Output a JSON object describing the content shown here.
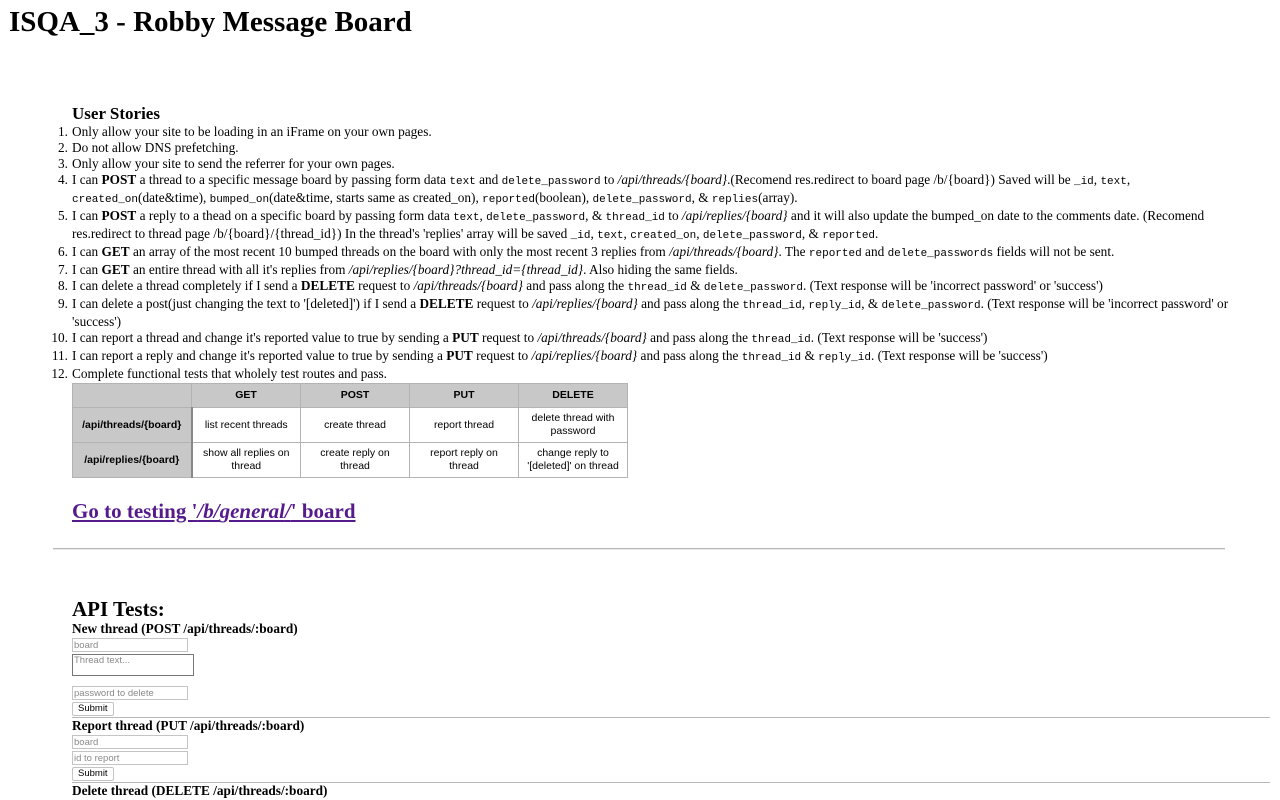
{
  "page": {
    "title": "ISQA_3 - Robby Message Board"
  },
  "stories": {
    "heading": "User Stories",
    "items": {
      "s1": "Only allow your site to be loading in an iFrame on your own pages.",
      "s2": "Do not allow DNS prefetching.",
      "s3": "Only allow your site to send the referrer for your own pages.",
      "s4": {
        "a": "I can ",
        "b": "POST",
        "c": " a thread to a specific message board by passing form data ",
        "d": "text",
        "e": " and ",
        "f": "delete_password",
        "g": " to ",
        "h": "/api/threads/{board}",
        "i": ".(Recomend res.redirect to board page /b/{board}) Saved will be ",
        "j": "_id",
        "k": ", ",
        "l": "text",
        "m": ", ",
        "n": "created_on",
        "o": "(date&time), ",
        "p": "bumped_on",
        "q": "(date&time, starts same as created_on), ",
        "r": "reported",
        "s": "(boolean), ",
        "t": "delete_password",
        "u": ", & ",
        "v": "replies",
        "w": "(array)."
      },
      "s5": {
        "a": "I can ",
        "b": "POST",
        "c": " a reply to a thead on a specific board by passing form data ",
        "d": "text",
        "e": ", ",
        "f": "delete_password",
        "g": ", & ",
        "h": "thread_id",
        "i": " to ",
        "j": "/api/replies/{board}",
        "k": " and it will also update the bumped_on date to the comments date. (Recomend res.redirect to thread page /b/{board}/{thread_id}) In the thread's 'replies' array will be saved ",
        "l": "_id",
        "m": ", ",
        "n": "text",
        "o": ", ",
        "p": "created_on",
        "q": ", ",
        "r": "delete_password",
        "s": ", & ",
        "t": "reported",
        "u": "."
      },
      "s6": {
        "a": "I can ",
        "b": "GET",
        "c": " an array of the most recent 10 bumped threads on the board with only the most recent 3 replies from ",
        "d": "/api/threads/{board}",
        "e": ". The ",
        "f": "reported",
        "g": " and ",
        "h": "delete_passwords",
        "i": " fields will not be sent."
      },
      "s7": {
        "a": "I can ",
        "b": "GET",
        "c": " an entire thread with all it's replies from ",
        "d": "/api/replies/{board}?thread_id={thread_id}",
        "e": ". Also hiding the same fields."
      },
      "s8": {
        "a": "I can delete a thread completely if I send a ",
        "b": "DELETE",
        "c": " request to ",
        "d": "/api/threads/{board}",
        "e": " and pass along the ",
        "f": "thread_id",
        "g": " & ",
        "h": "delete_password",
        "i": ". (Text response will be 'incorrect password' or 'success')"
      },
      "s9": {
        "a": "I can delete a post(just changing the text to '[deleted]') if I send a ",
        "b": "DELETE",
        "c": " request to ",
        "d": "/api/replies/{board}",
        "e": " and pass along the ",
        "f": "thread_id",
        "g": ", ",
        "h": "reply_id",
        "i": ", & ",
        "j": "delete_password",
        "k": ". (Text response will be 'incorrect password' or 'success')"
      },
      "s10": {
        "a": "I can report a thread and change it's reported value to true by sending a ",
        "b": "PUT",
        "c": " request to ",
        "d": "/api/threads/{board}",
        "e": " and pass along the ",
        "f": "thread_id",
        "g": ". (Text response will be 'success')"
      },
      "s11": {
        "a": "I can report a reply and change it's reported value to true by sending a ",
        "b": "PUT",
        "c": " request to ",
        "d": "/api/replies/{board}",
        "e": " and pass along the ",
        "f": "thread_id",
        "g": " & ",
        "h": "reply_id",
        "i": ". (Text response will be 'success')"
      },
      "s12": "Complete functional tests that wholely test routes and pass."
    }
  },
  "routes_table": {
    "headers": [
      "",
      "GET",
      "POST",
      "PUT",
      "DELETE"
    ],
    "rows": [
      {
        "route": "/api/threads/{board}",
        "get": "list recent threads",
        "post": "create thread",
        "put": "report thread",
        "delete": "delete thread with password"
      },
      {
        "route": "/api/replies/{board}",
        "get": "show all replies on thread",
        "post": "create reply on thread",
        "put": "report reply on thread",
        "delete": "change reply to '[deleted]' on thread"
      }
    ]
  },
  "test_link": {
    "before": "Go to testing '",
    "path_a": "/b/",
    "path_b": "general",
    "path_c": "/",
    "after": "' board"
  },
  "api_tests": {
    "heading": "API Tests:",
    "new_thread": {
      "title": "New thread (POST /api/threads/:board)",
      "board_placeholder": "board",
      "text_placeholder": "Thread text...",
      "password_placeholder": "password to delete",
      "submit": "Submit"
    },
    "report_thread": {
      "title": "Report thread (PUT /api/threads/:board)",
      "board_placeholder": "board",
      "id_placeholder": "id to report",
      "submit": "Submit"
    },
    "delete_thread": {
      "title": "Delete thread (DELETE /api/threads/:board)"
    }
  }
}
